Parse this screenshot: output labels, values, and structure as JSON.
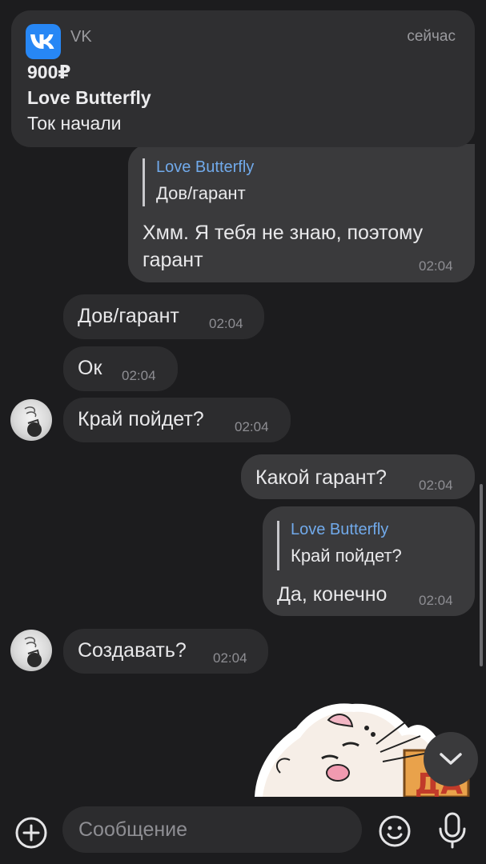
{
  "notification": {
    "app_name": "VK",
    "time": "сейчас",
    "amount": "900₽",
    "sender": "Love Butterfly",
    "body": "Ток начали"
  },
  "messages": [
    {
      "direction": "out",
      "reply_name": "Love Butterfly",
      "reply_text": "Дов/гарант",
      "text_line1": "Хмм. Я тебя не знаю, поэтому",
      "text_line2": "гарант",
      "time": "02:04"
    },
    {
      "direction": "in",
      "text": "Дов/гарант",
      "time": "02:04"
    },
    {
      "direction": "in",
      "text": "Ок",
      "time": "02:04"
    },
    {
      "direction": "in",
      "text": "Край пойдет?",
      "time": "02:04"
    },
    {
      "direction": "out",
      "text": "Какой гарант?",
      "time": "02:04"
    },
    {
      "direction": "out",
      "reply_name": "Love Butterfly",
      "reply_text": "Край пойдет?",
      "text": "Да, конечно",
      "time": "02:04"
    },
    {
      "direction": "in",
      "text": "Создавать?",
      "time": "02:04"
    }
  ],
  "composer": {
    "placeholder": "Сообщение"
  },
  "colors": {
    "background": "#1c1c1e",
    "incoming_bubble": "#2c2c2e",
    "outgoing_bubble": "#3a3a3c",
    "reply_name": "#71aaeb",
    "vk_brand": "#2787f5"
  },
  "icons": [
    "vk-logo-icon",
    "plus-circle-icon",
    "emoji-icon",
    "microphone-icon",
    "chevron-down-icon"
  ]
}
